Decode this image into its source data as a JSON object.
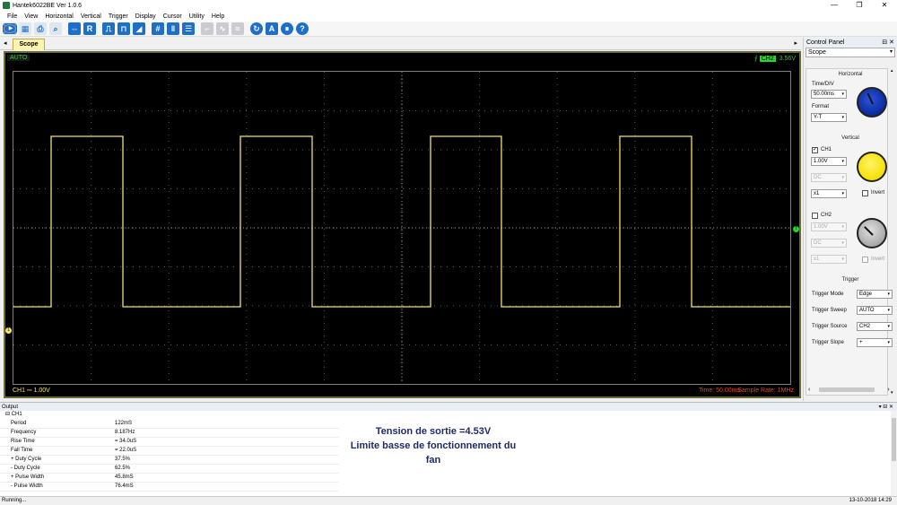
{
  "window": {
    "title": "Hantek6022BE Ver 1.0.6",
    "controls": [
      "—",
      "❐",
      "✕"
    ]
  },
  "menu": [
    "File",
    "View",
    "Horizontal",
    "Vertical",
    "Trigger",
    "Display",
    "Cursor",
    "Utility",
    "Help"
  ],
  "tabs": {
    "active": "Scope"
  },
  "scope": {
    "mode_badge": "AUTO",
    "trigger_channel": "CH2",
    "trigger_level": "3.56V",
    "ch1_scale": "CH1 ⎓   1.00V",
    "time_div": "Time: 50.00ms",
    "sample_rate": "Sample Rate: 1MHz",
    "trace_color": "#f2e26a",
    "grid_color": "#5a5a5a"
  },
  "control_panel": {
    "title": "Control Panel",
    "selected": "Scope",
    "horizontal": {
      "section": "Horizontal",
      "time_div_label": "Time/DIV",
      "time_div_value": "50.00ms",
      "format_label": "Format",
      "format_value": "Y-T"
    },
    "vertical": {
      "section": "Vertical",
      "ch1_label": "CH1",
      "ch1_volts": "1.00V",
      "ch1_coupling": "DC",
      "ch1_probe": "x1",
      "ch1_invert": "Invert",
      "ch2_label": "CH2",
      "ch2_volts": "1.00V",
      "ch2_coupling": "DC",
      "ch2_probe": "x1",
      "ch2_invert": "Invert"
    },
    "trigger": {
      "section": "Trigger",
      "mode_label": "Trigger Mode",
      "mode_value": "Edge",
      "sweep_label": "Trigger Sweep",
      "sweep_value": "AUTO",
      "source_label": "Trigger Source",
      "source_value": "CH2",
      "slope_label": "Trigger Slope",
      "slope_value": "+"
    }
  },
  "output": {
    "title": "Output",
    "channel": "CH1",
    "measurements": [
      {
        "name": "Period",
        "value": "122mS"
      },
      {
        "name": "Frequency",
        "value": "8.187Hz"
      },
      {
        "name": "Rise Time",
        "value": "= 34.0uS"
      },
      {
        "name": "Fall Time",
        "value": "= 22.0uS"
      },
      {
        "name": "+ Duty Cycle",
        "value": "37.5%"
      },
      {
        "name": "- Duty Cycle",
        "value": "62.5%"
      },
      {
        "name": "+ Pulse Width",
        "value": "45.8mS"
      },
      {
        "name": "- Pulse Width",
        "value": "76.4mS"
      }
    ],
    "note_line1": "Tension de sortie =4.53V",
    "note_line2": "Limite basse de fonctionnement du",
    "note_line3": "fan"
  },
  "status": {
    "left": "Running...",
    "right": "13-10-2018  14:29"
  }
}
